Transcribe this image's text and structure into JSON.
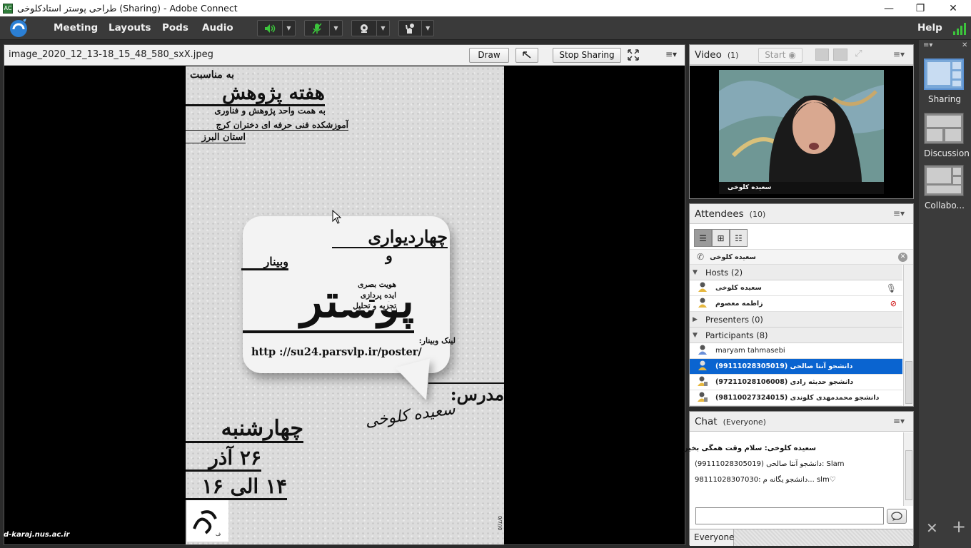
{
  "window": {
    "title": "طراحی پوستر استادکلوخی (Sharing) - Adobe Connect",
    "controls": {
      "minimize": "—",
      "maximize": "❐",
      "close": "✕"
    }
  },
  "menubar": {
    "items": [
      "Meeting",
      "Layouts",
      "Pods",
      "Audio"
    ],
    "help": "Help",
    "colors": {
      "speaker": "#3cc43c",
      "mic": "#3cc43c",
      "signal": "#3cc43c"
    }
  },
  "share_pod": {
    "file_name": "image_2020_12_13-18_15_48_580_sxX.jpeg",
    "draw_label": "Draw",
    "stop_sharing_label": "Stop Sharing",
    "poster": {
      "line1": "به مناسبت",
      "line2": "هفته پژوهش",
      "line3": "به همت واحد پژوهش و فناوری",
      "line4": "آموزشکده فنی حرفه ای دختران کرج",
      "line5": "استان البرز",
      "bubble_title": "چهاردیواری",
      "bubble_and": "و",
      "bubble_webinar": "وبینار",
      "bubble_big": "پوستر",
      "bubble_topics": [
        "هویت بصری",
        "ایده پردازی",
        "تجزیه و تحلیل"
      ],
      "link_label": "لینک وبینار:",
      "url": "http ://su24.parsvlp.ir/poster/",
      "teacher_label": "مدرس:",
      "teacher_name": "سعیده کلوخی",
      "day": "چهارشنبه",
      "date": "۲۶ آذر",
      "time": "۱۴ الی ۱۶"
    }
  },
  "watermark": "d-karaj.nus.ac.ir",
  "video_pod": {
    "title": "Video",
    "count": "(1)",
    "start_label": "Start",
    "speaker_name": "سعیده کلوخی"
  },
  "attendees_pod": {
    "title": "Attendees",
    "count": "(10)",
    "speaking": "سعیده کلوخی",
    "groups": {
      "hosts": "Hosts (2)",
      "presenters": "Presenters (0)",
      "participants": "Participants (8)"
    },
    "hosts": [
      "سعیده کلوخی",
      "زاطمه معصوم"
    ],
    "participants": [
      "maryam tahmasebi",
      "دانشجو آنتا صالحی (99111028305019)",
      "دانشجو حدیثه رادی (97211028106008)",
      "دانشجو محمدمهدی کلوندی (98110027324015)"
    ],
    "selected_participant_index": 1
  },
  "chat_pod": {
    "title": "Chat",
    "scope": "(Everyone)",
    "messages": [
      "سعیده کلوخی: سلام وقت همگی بخیر",
      "دانشجو آنتا صالحی (99111028305019): Slam",
      "98111028307030: دانشجو یگانه م... slm♡"
    ],
    "recipient": "Everyone"
  },
  "layouts_bar": {
    "items": [
      "Sharing",
      "Discussion",
      "Collabo..."
    ],
    "active": "Sharing"
  }
}
